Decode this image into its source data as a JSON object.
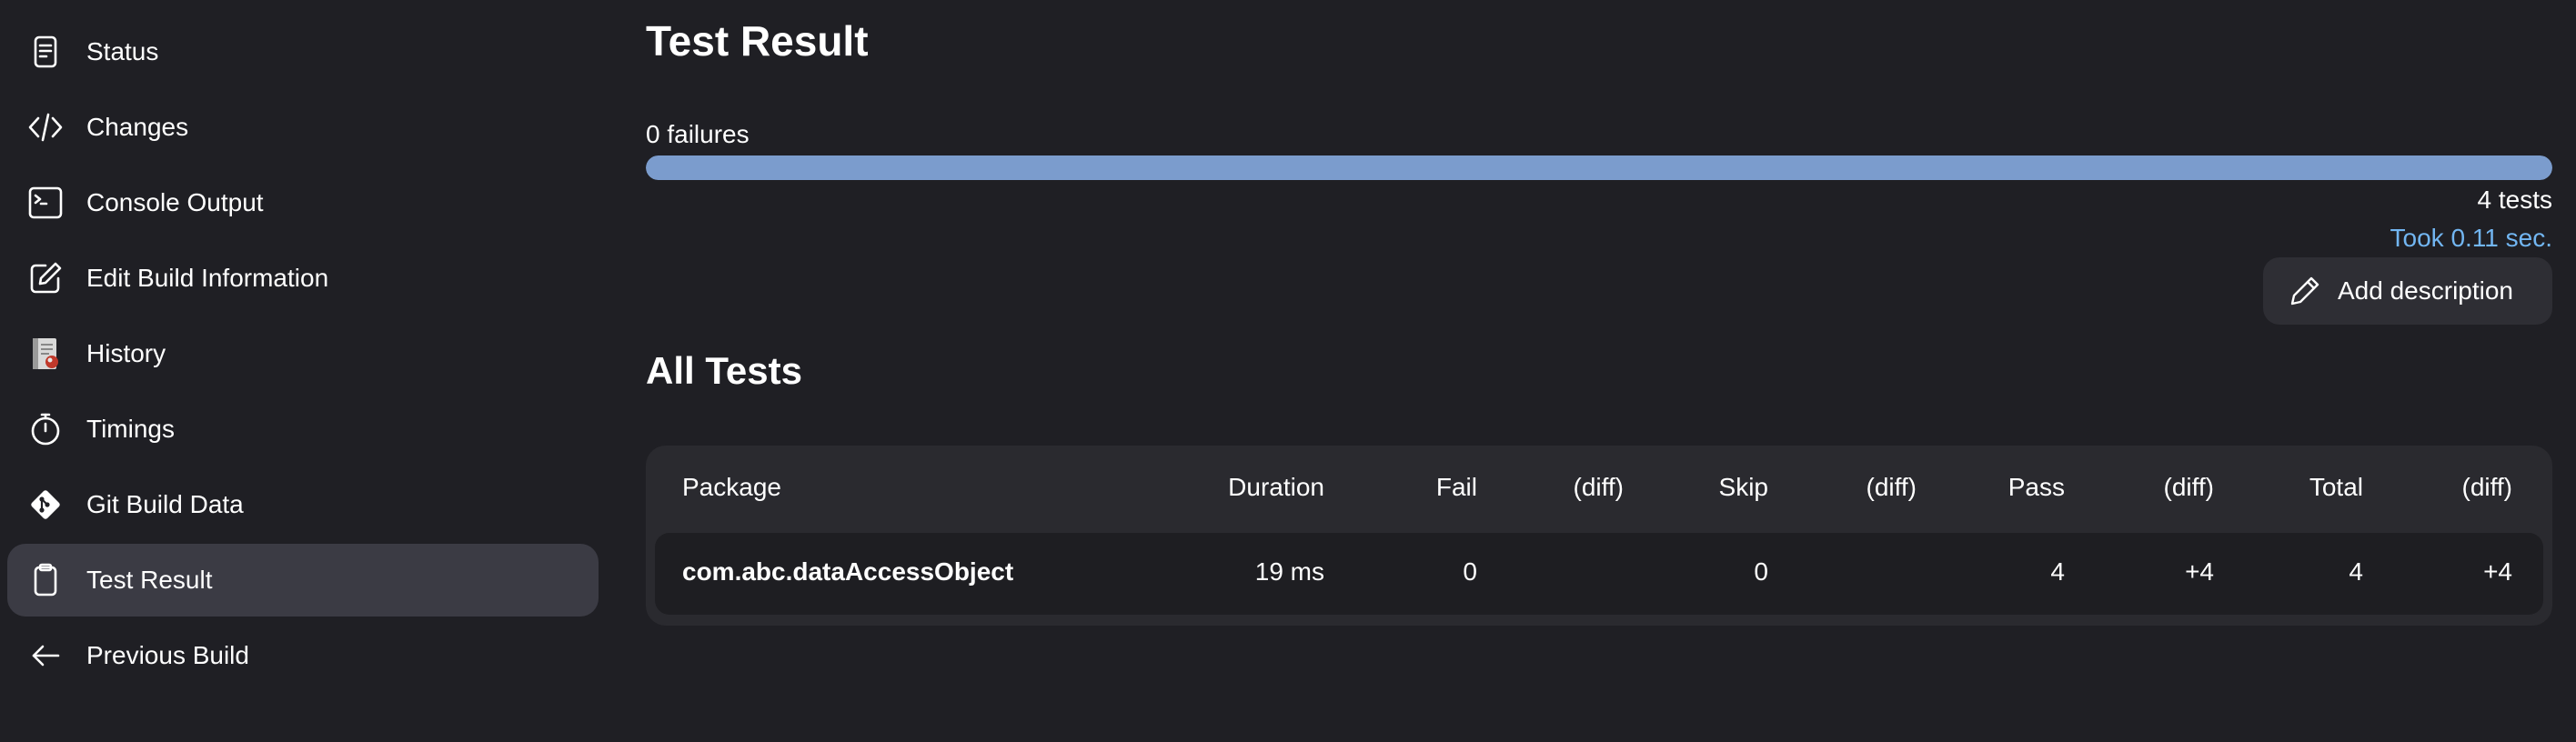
{
  "sidebar": {
    "items": [
      {
        "label": "Status",
        "icon": "document-icon"
      },
      {
        "label": "Changes",
        "icon": "code-icon"
      },
      {
        "label": "Console Output",
        "icon": "terminal-icon"
      },
      {
        "label": "Edit Build Information",
        "icon": "edit-icon"
      },
      {
        "label": "History",
        "icon": "history-icon"
      },
      {
        "label": "Timings",
        "icon": "stopwatch-icon"
      },
      {
        "label": "Git Build Data",
        "icon": "git-icon"
      },
      {
        "label": "Test Result",
        "icon": "clipboard-icon",
        "active": true
      },
      {
        "label": "Previous Build",
        "icon": "arrow-left-icon"
      }
    ]
  },
  "main": {
    "title": "Test Result",
    "failures_label": "0 failures",
    "progress_fraction": 1.0,
    "tests_count": "4 tests",
    "took": "Took 0.11 sec.",
    "add_description": "Add description",
    "section_title": "All Tests"
  },
  "table": {
    "headers": [
      "Package",
      "Duration",
      "Fail",
      "(diff)",
      "Skip",
      "(diff)",
      "Pass",
      "(diff)",
      "Total",
      "(diff)"
    ],
    "rows": [
      [
        "com.abc.dataAccessObject",
        "19 ms",
        "0",
        "",
        "0",
        "",
        "4",
        "+4",
        "4",
        "+4"
      ]
    ]
  },
  "colors": {
    "background": "#1f1f24",
    "active_item": "#3b3b44",
    "progress_pass": "#7b9ccd",
    "link": "#72b6f2"
  }
}
